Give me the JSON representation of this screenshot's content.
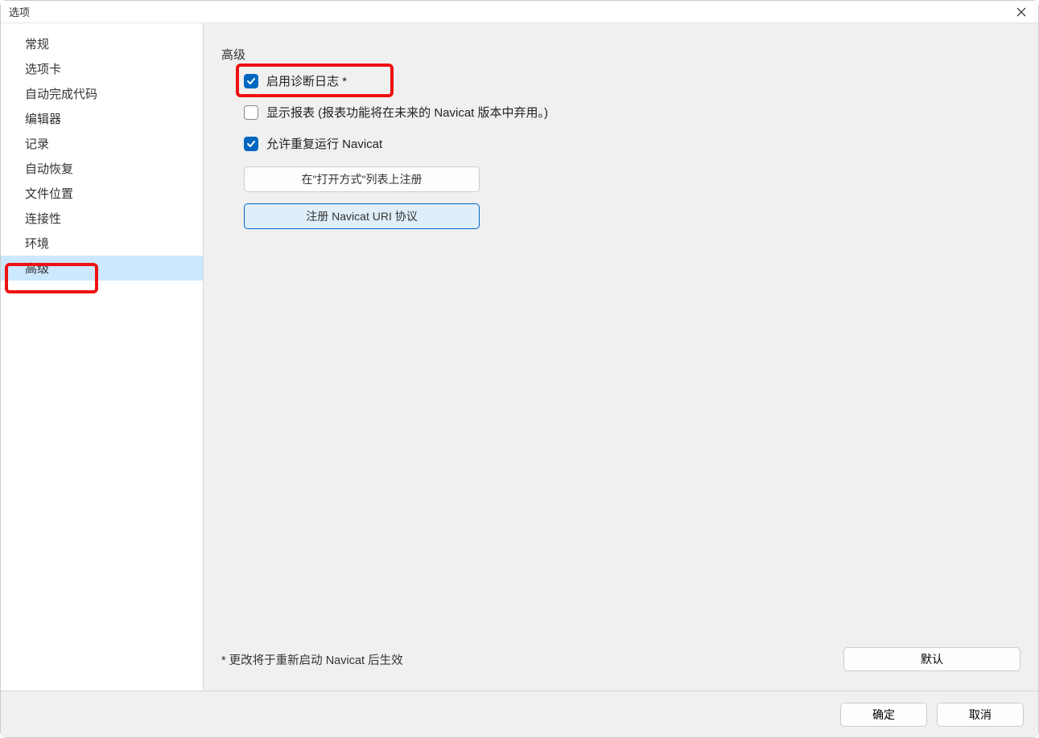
{
  "window": {
    "title": "选项"
  },
  "sidebar": {
    "items": [
      {
        "label": "常规",
        "selected": false
      },
      {
        "label": "选项卡",
        "selected": false
      },
      {
        "label": "自动完成代码",
        "selected": false
      },
      {
        "label": "编辑器",
        "selected": false
      },
      {
        "label": "记录",
        "selected": false
      },
      {
        "label": "自动恢复",
        "selected": false
      },
      {
        "label": "文件位置",
        "selected": false
      },
      {
        "label": "连接性",
        "selected": false
      },
      {
        "label": "环境",
        "selected": false
      },
      {
        "label": "高级",
        "selected": true
      }
    ]
  },
  "main": {
    "section_title": "高级",
    "checkboxes": [
      {
        "label": "启用诊断日志 *",
        "checked": true
      },
      {
        "label": "显示报表 (报表功能将在未来的 Navicat 版本中弃用。)",
        "checked": false
      },
      {
        "label": "允许重复运行 Navicat",
        "checked": true
      }
    ],
    "buttons": {
      "register_open_with": "在\"打开方式\"列表上注册",
      "register_uri": "注册 Navicat URI 协议"
    },
    "note": "* 更改将于重新启动 Navicat 后生效",
    "default_button": "默认"
  },
  "footer": {
    "ok": "确定",
    "cancel": "取消"
  },
  "colors": {
    "accent": "#0067c0",
    "highlight_border": "#e11"
  }
}
